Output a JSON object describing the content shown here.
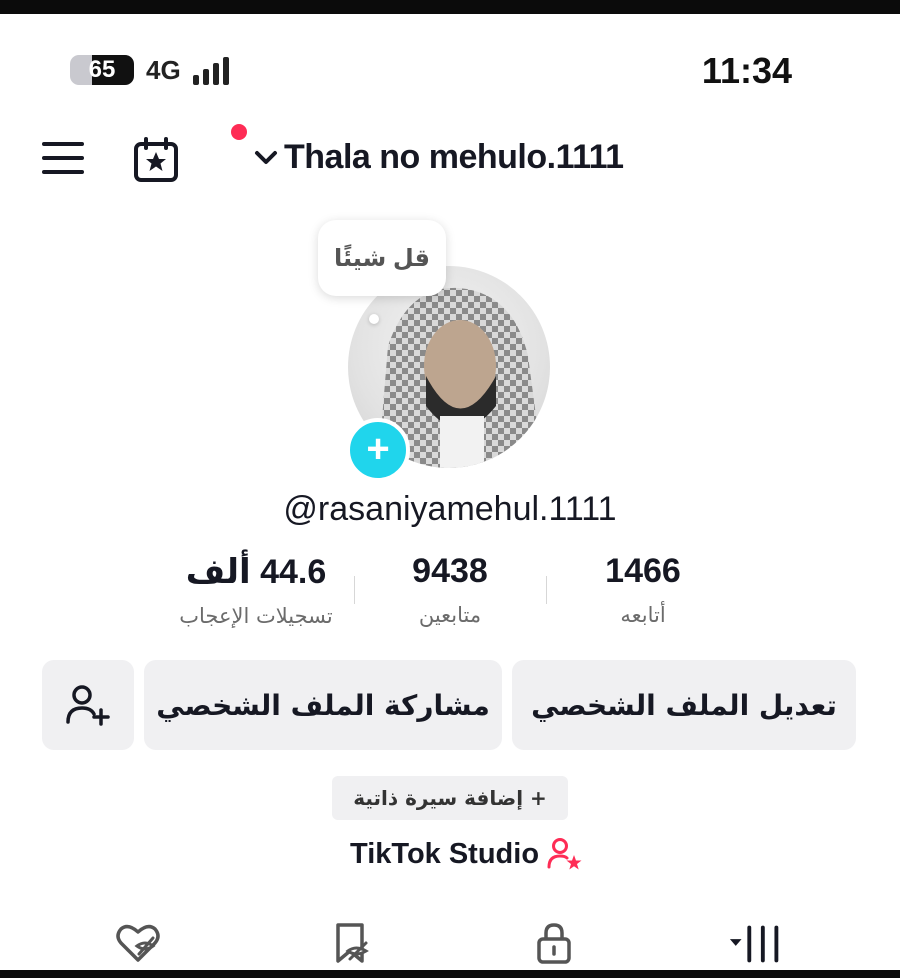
{
  "status_bar": {
    "battery_level": "65",
    "network": "4G",
    "time": "11:34"
  },
  "header": {
    "account_name": "Thala no mehulo.1111",
    "notification_dot_color": "#fe2c55"
  },
  "profile": {
    "note_bubble": "قل شيئًا",
    "username": "@rasaniyamehul.1111",
    "add_photo_symbol": "+"
  },
  "stats": [
    {
      "value": "44.6 ألف",
      "label": "تسجيلات الإعجاب"
    },
    {
      "value": "9438",
      "label": "متابعين"
    },
    {
      "value": "1466",
      "label": "أتابعه"
    }
  ],
  "actions": {
    "edit_profile": "تعديل الملف الشخصي",
    "share_profile": "مشاركة الملف الشخصي",
    "add_friend_icon": "add-user-icon"
  },
  "bio": {
    "add_bio": "+ إضافة سيرة ذاتية"
  },
  "studio": {
    "label": "TikTok Studio"
  },
  "tabs": [
    {
      "icon": "heart-hidden-icon"
    },
    {
      "icon": "bookmark-hidden-icon"
    },
    {
      "icon": "lock-icon"
    },
    {
      "icon": "grid-icon"
    }
  ],
  "colors": {
    "accent_pink": "#fe2c55",
    "add_photo_cyan": "#20d5ec",
    "button_bg": "#f0f0f2"
  }
}
